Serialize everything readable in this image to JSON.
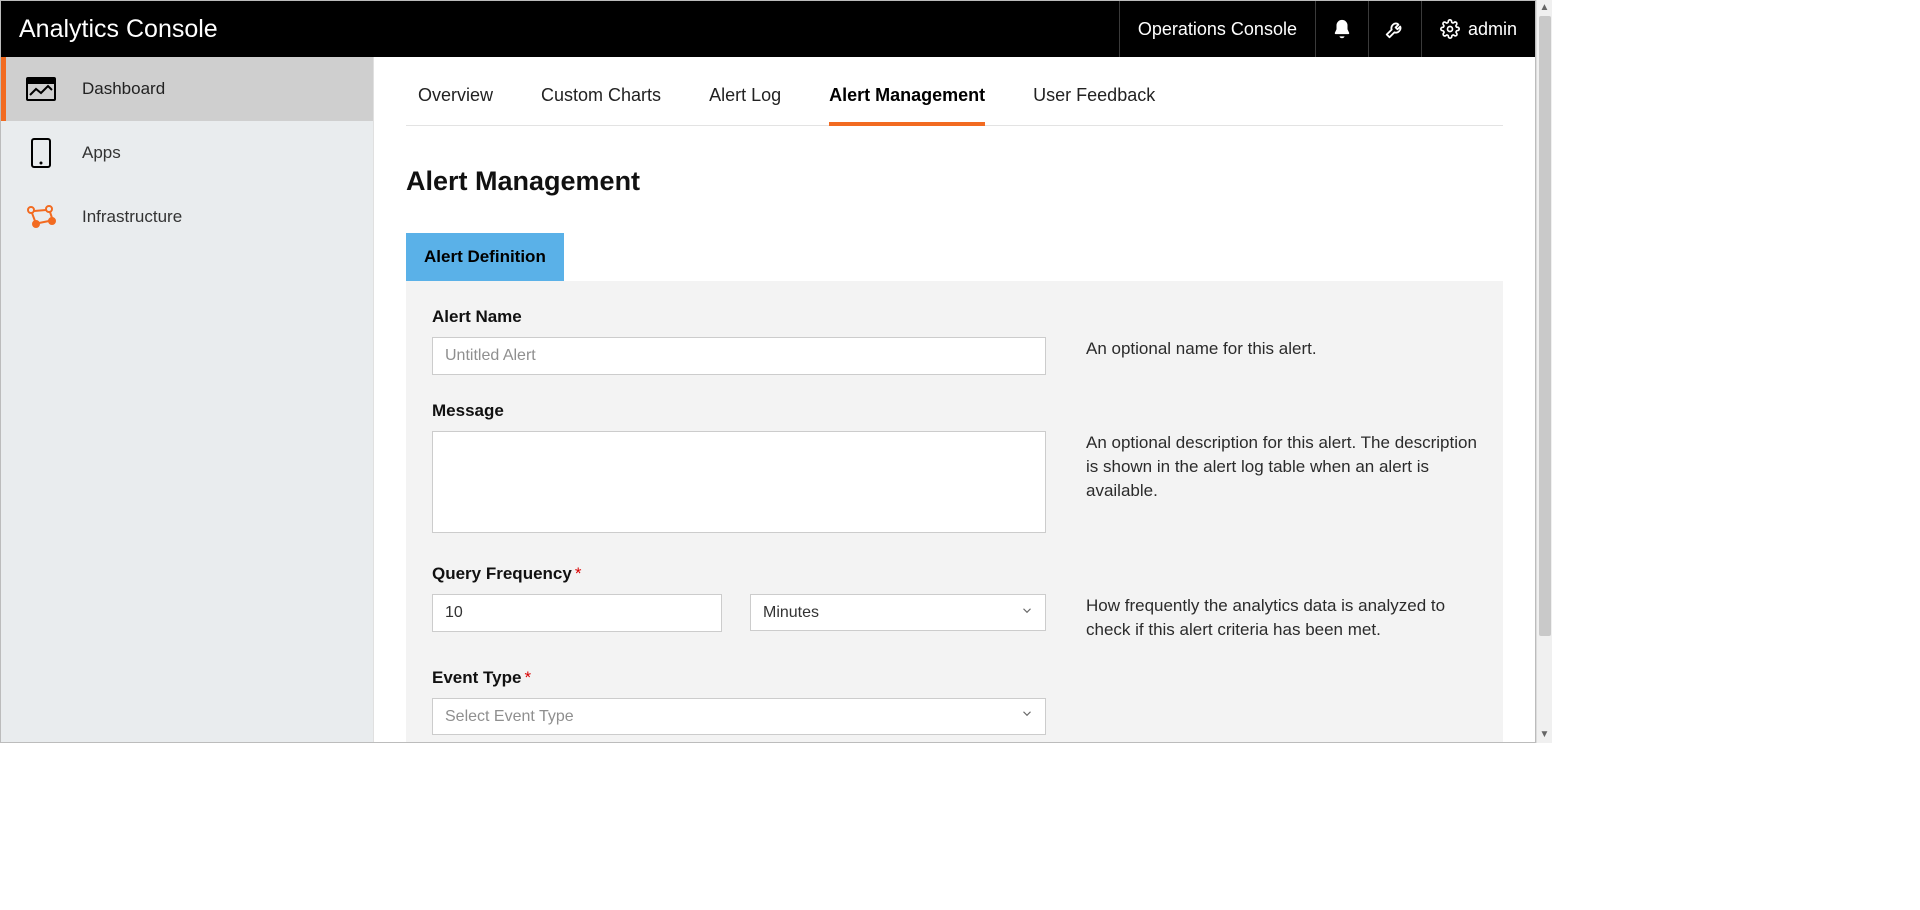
{
  "header": {
    "brand": "Analytics Console",
    "operations_console": "Operations Console",
    "admin_label": "admin"
  },
  "sidebar": {
    "items": [
      {
        "label": "Dashboard"
      },
      {
        "label": "Apps"
      },
      {
        "label": "Infrastructure"
      }
    ]
  },
  "tabs": [
    {
      "label": "Overview"
    },
    {
      "label": "Custom Charts"
    },
    {
      "label": "Alert Log"
    },
    {
      "label": "Alert Management"
    },
    {
      "label": "User Feedback"
    }
  ],
  "page": {
    "title": "Alert Management",
    "subtab": "Alert Definition"
  },
  "form": {
    "alert_name": {
      "label": "Alert Name",
      "placeholder": "Untitled Alert",
      "value": "",
      "help": "An optional name for this alert."
    },
    "message": {
      "label": "Message",
      "value": "",
      "help": "An optional description for this alert. The description is shown in the alert log table when an alert is available."
    },
    "query_frequency": {
      "label": "Query Frequency",
      "required_mark": "*",
      "value": "10",
      "unit_selected": "Minutes",
      "help": "How frequently the analytics data is analyzed to check if this alert criteria has been met."
    },
    "event_type": {
      "label": "Event Type",
      "required_mark": "*",
      "placeholder": "Select Event Type"
    }
  }
}
